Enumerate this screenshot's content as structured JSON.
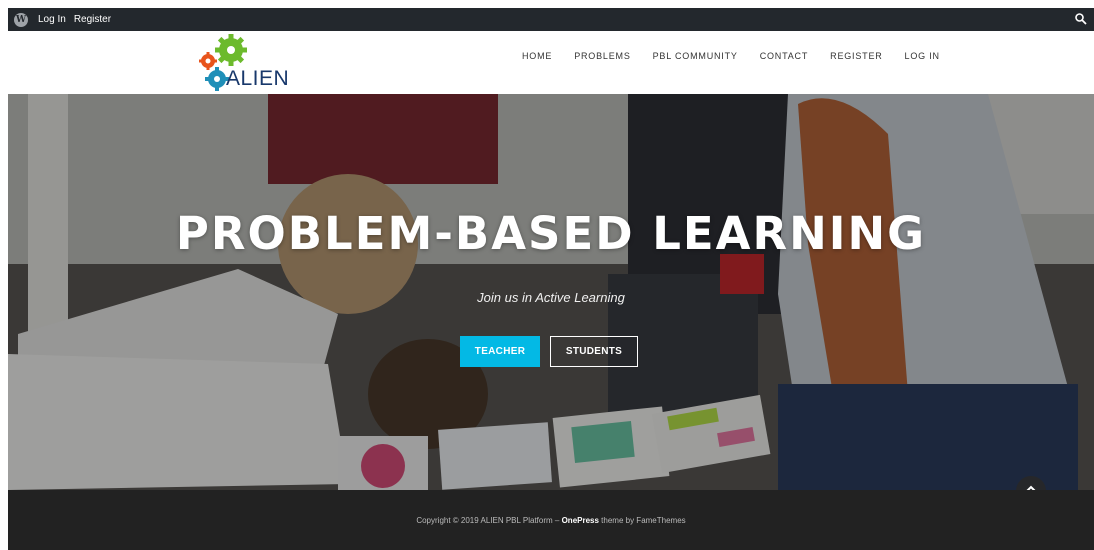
{
  "adminbar": {
    "login": "Log In",
    "register": "Register"
  },
  "brand": {
    "name": "ALIEN"
  },
  "nav": {
    "items": [
      "HOME",
      "PROBLEMS",
      "PBL COMMUNITY",
      "CONTACT",
      "REGISTER",
      "LOG IN"
    ]
  },
  "hero": {
    "title": "PROBLEM-BASED LEARNING",
    "subtitle": "Join us in Active Learning",
    "primary_button": "TEACHER",
    "secondary_button": "STUDENTS"
  },
  "footer": {
    "copyright": "Copyright © 2019 ALIEN PBL Platform –",
    "theme": "OnePress",
    "theme_suffix": "theme by FameThemes"
  },
  "colors": {
    "adminbar": "#23282d",
    "accent": "#03b9e5",
    "footer": "#222222",
    "logo_text": "#18386b"
  }
}
